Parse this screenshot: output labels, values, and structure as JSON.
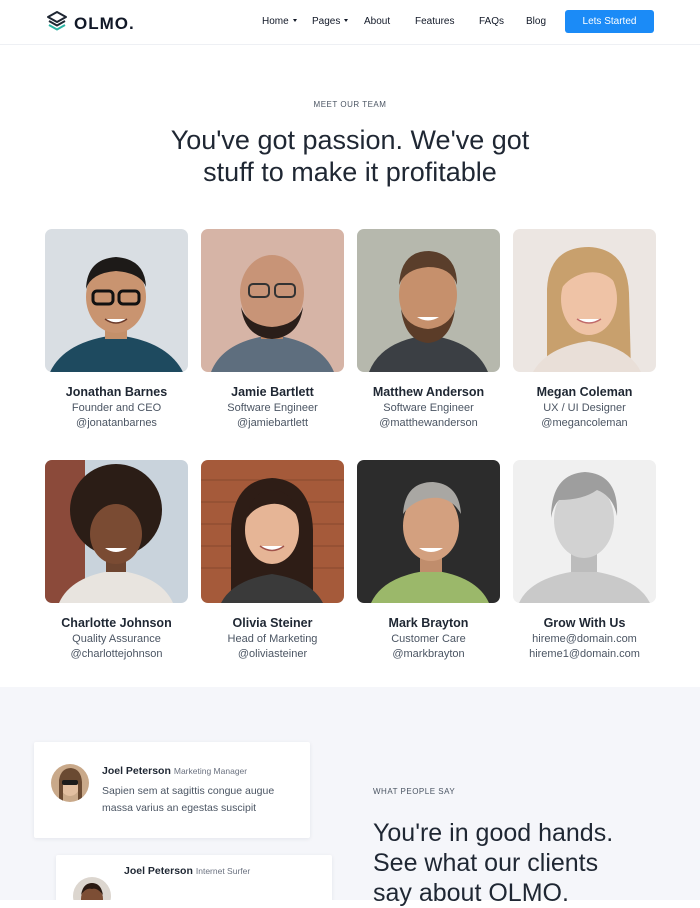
{
  "brand": {
    "name": "OLMO.",
    "accent": "#1b8bf7",
    "logo_icon": "layers-icon"
  },
  "nav": {
    "items": [
      "Home",
      "Pages",
      "About",
      "Features",
      "FAQs",
      "Blog"
    ],
    "cta": "Lets Started"
  },
  "team": {
    "eyebrow": "MEET OUR TEAM",
    "headline_line1": "You've got passion. We've got",
    "headline_line2": "stuff to make it profitable",
    "members": [
      {
        "name": "Jonathan Barnes",
        "role": "Founder and CEO",
        "handle": "@jonatanbarnes"
      },
      {
        "name": "Jamie Bartlett",
        "role": "Software Engineer",
        "handle": "@jamiebartlett"
      },
      {
        "name": "Matthew Anderson",
        "role": "Software Engineer",
        "handle": "@matthewanderson"
      },
      {
        "name": "Megan Coleman",
        "role": "UX / UI Designer",
        "handle": "@megancoleman"
      },
      {
        "name": "Charlotte Johnson",
        "role": "Quality Assurance",
        "handle": "@charlottejohnson"
      },
      {
        "name": "Olivia Steiner",
        "role": "Head of Marketing",
        "handle": "@oliviasteiner"
      },
      {
        "name": "Mark Brayton",
        "role": "Customer Care",
        "handle": "@markbrayton"
      },
      {
        "name": "Grow With Us",
        "role": "hireme@domain.com",
        "handle": "hireme1@domain.com"
      }
    ]
  },
  "testimonials": {
    "eyebrow": "WHAT PEOPLE SAY",
    "headline_line1": "You're in good hands.",
    "headline_line2": "See what our clients",
    "headline_line3": "say about OLMO.",
    "items": [
      {
        "name": "Joel Peterson",
        "job": "Marketing Manager",
        "quote_line1": "Sapien sem at sagittis congue augue",
        "quote_line2": "massa varius an egestas suscipit"
      },
      {
        "name": "Joel Peterson",
        "job": "Internet Surfer"
      }
    ]
  }
}
